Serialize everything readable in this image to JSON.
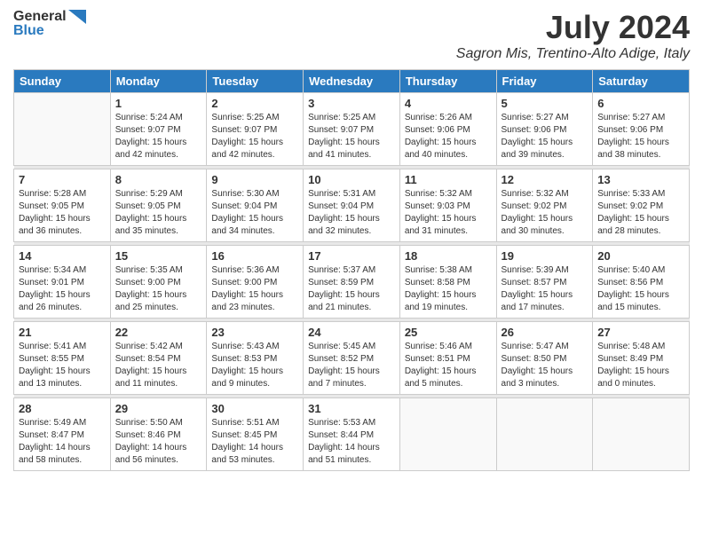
{
  "logo": {
    "line1": "General",
    "line2": "Blue"
  },
  "title": "July 2024",
  "location": "Sagron Mis, Trentino-Alto Adige, Italy",
  "weekdays": [
    "Sunday",
    "Monday",
    "Tuesday",
    "Wednesday",
    "Thursday",
    "Friday",
    "Saturday"
  ],
  "weeks": [
    [
      {
        "day": "",
        "info": ""
      },
      {
        "day": "1",
        "info": "Sunrise: 5:24 AM\nSunset: 9:07 PM\nDaylight: 15 hours\nand 42 minutes."
      },
      {
        "day": "2",
        "info": "Sunrise: 5:25 AM\nSunset: 9:07 PM\nDaylight: 15 hours\nand 42 minutes."
      },
      {
        "day": "3",
        "info": "Sunrise: 5:25 AM\nSunset: 9:07 PM\nDaylight: 15 hours\nand 41 minutes."
      },
      {
        "day": "4",
        "info": "Sunrise: 5:26 AM\nSunset: 9:06 PM\nDaylight: 15 hours\nand 40 minutes."
      },
      {
        "day": "5",
        "info": "Sunrise: 5:27 AM\nSunset: 9:06 PM\nDaylight: 15 hours\nand 39 minutes."
      },
      {
        "day": "6",
        "info": "Sunrise: 5:27 AM\nSunset: 9:06 PM\nDaylight: 15 hours\nand 38 minutes."
      }
    ],
    [
      {
        "day": "7",
        "info": "Sunrise: 5:28 AM\nSunset: 9:05 PM\nDaylight: 15 hours\nand 36 minutes."
      },
      {
        "day": "8",
        "info": "Sunrise: 5:29 AM\nSunset: 9:05 PM\nDaylight: 15 hours\nand 35 minutes."
      },
      {
        "day": "9",
        "info": "Sunrise: 5:30 AM\nSunset: 9:04 PM\nDaylight: 15 hours\nand 34 minutes."
      },
      {
        "day": "10",
        "info": "Sunrise: 5:31 AM\nSunset: 9:04 PM\nDaylight: 15 hours\nand 32 minutes."
      },
      {
        "day": "11",
        "info": "Sunrise: 5:32 AM\nSunset: 9:03 PM\nDaylight: 15 hours\nand 31 minutes."
      },
      {
        "day": "12",
        "info": "Sunrise: 5:32 AM\nSunset: 9:02 PM\nDaylight: 15 hours\nand 30 minutes."
      },
      {
        "day": "13",
        "info": "Sunrise: 5:33 AM\nSunset: 9:02 PM\nDaylight: 15 hours\nand 28 minutes."
      }
    ],
    [
      {
        "day": "14",
        "info": "Sunrise: 5:34 AM\nSunset: 9:01 PM\nDaylight: 15 hours\nand 26 minutes."
      },
      {
        "day": "15",
        "info": "Sunrise: 5:35 AM\nSunset: 9:00 PM\nDaylight: 15 hours\nand 25 minutes."
      },
      {
        "day": "16",
        "info": "Sunrise: 5:36 AM\nSunset: 9:00 PM\nDaylight: 15 hours\nand 23 minutes."
      },
      {
        "day": "17",
        "info": "Sunrise: 5:37 AM\nSunset: 8:59 PM\nDaylight: 15 hours\nand 21 minutes."
      },
      {
        "day": "18",
        "info": "Sunrise: 5:38 AM\nSunset: 8:58 PM\nDaylight: 15 hours\nand 19 minutes."
      },
      {
        "day": "19",
        "info": "Sunrise: 5:39 AM\nSunset: 8:57 PM\nDaylight: 15 hours\nand 17 minutes."
      },
      {
        "day": "20",
        "info": "Sunrise: 5:40 AM\nSunset: 8:56 PM\nDaylight: 15 hours\nand 15 minutes."
      }
    ],
    [
      {
        "day": "21",
        "info": "Sunrise: 5:41 AM\nSunset: 8:55 PM\nDaylight: 15 hours\nand 13 minutes."
      },
      {
        "day": "22",
        "info": "Sunrise: 5:42 AM\nSunset: 8:54 PM\nDaylight: 15 hours\nand 11 minutes."
      },
      {
        "day": "23",
        "info": "Sunrise: 5:43 AM\nSunset: 8:53 PM\nDaylight: 15 hours\nand 9 minutes."
      },
      {
        "day": "24",
        "info": "Sunrise: 5:45 AM\nSunset: 8:52 PM\nDaylight: 15 hours\nand 7 minutes."
      },
      {
        "day": "25",
        "info": "Sunrise: 5:46 AM\nSunset: 8:51 PM\nDaylight: 15 hours\nand 5 minutes."
      },
      {
        "day": "26",
        "info": "Sunrise: 5:47 AM\nSunset: 8:50 PM\nDaylight: 15 hours\nand 3 minutes."
      },
      {
        "day": "27",
        "info": "Sunrise: 5:48 AM\nSunset: 8:49 PM\nDaylight: 15 hours\nand 0 minutes."
      }
    ],
    [
      {
        "day": "28",
        "info": "Sunrise: 5:49 AM\nSunset: 8:47 PM\nDaylight: 14 hours\nand 58 minutes."
      },
      {
        "day": "29",
        "info": "Sunrise: 5:50 AM\nSunset: 8:46 PM\nDaylight: 14 hours\nand 56 minutes."
      },
      {
        "day": "30",
        "info": "Sunrise: 5:51 AM\nSunset: 8:45 PM\nDaylight: 14 hours\nand 53 minutes."
      },
      {
        "day": "31",
        "info": "Sunrise: 5:53 AM\nSunset: 8:44 PM\nDaylight: 14 hours\nand 51 minutes."
      },
      {
        "day": "",
        "info": ""
      },
      {
        "day": "",
        "info": ""
      },
      {
        "day": "",
        "info": ""
      }
    ]
  ]
}
